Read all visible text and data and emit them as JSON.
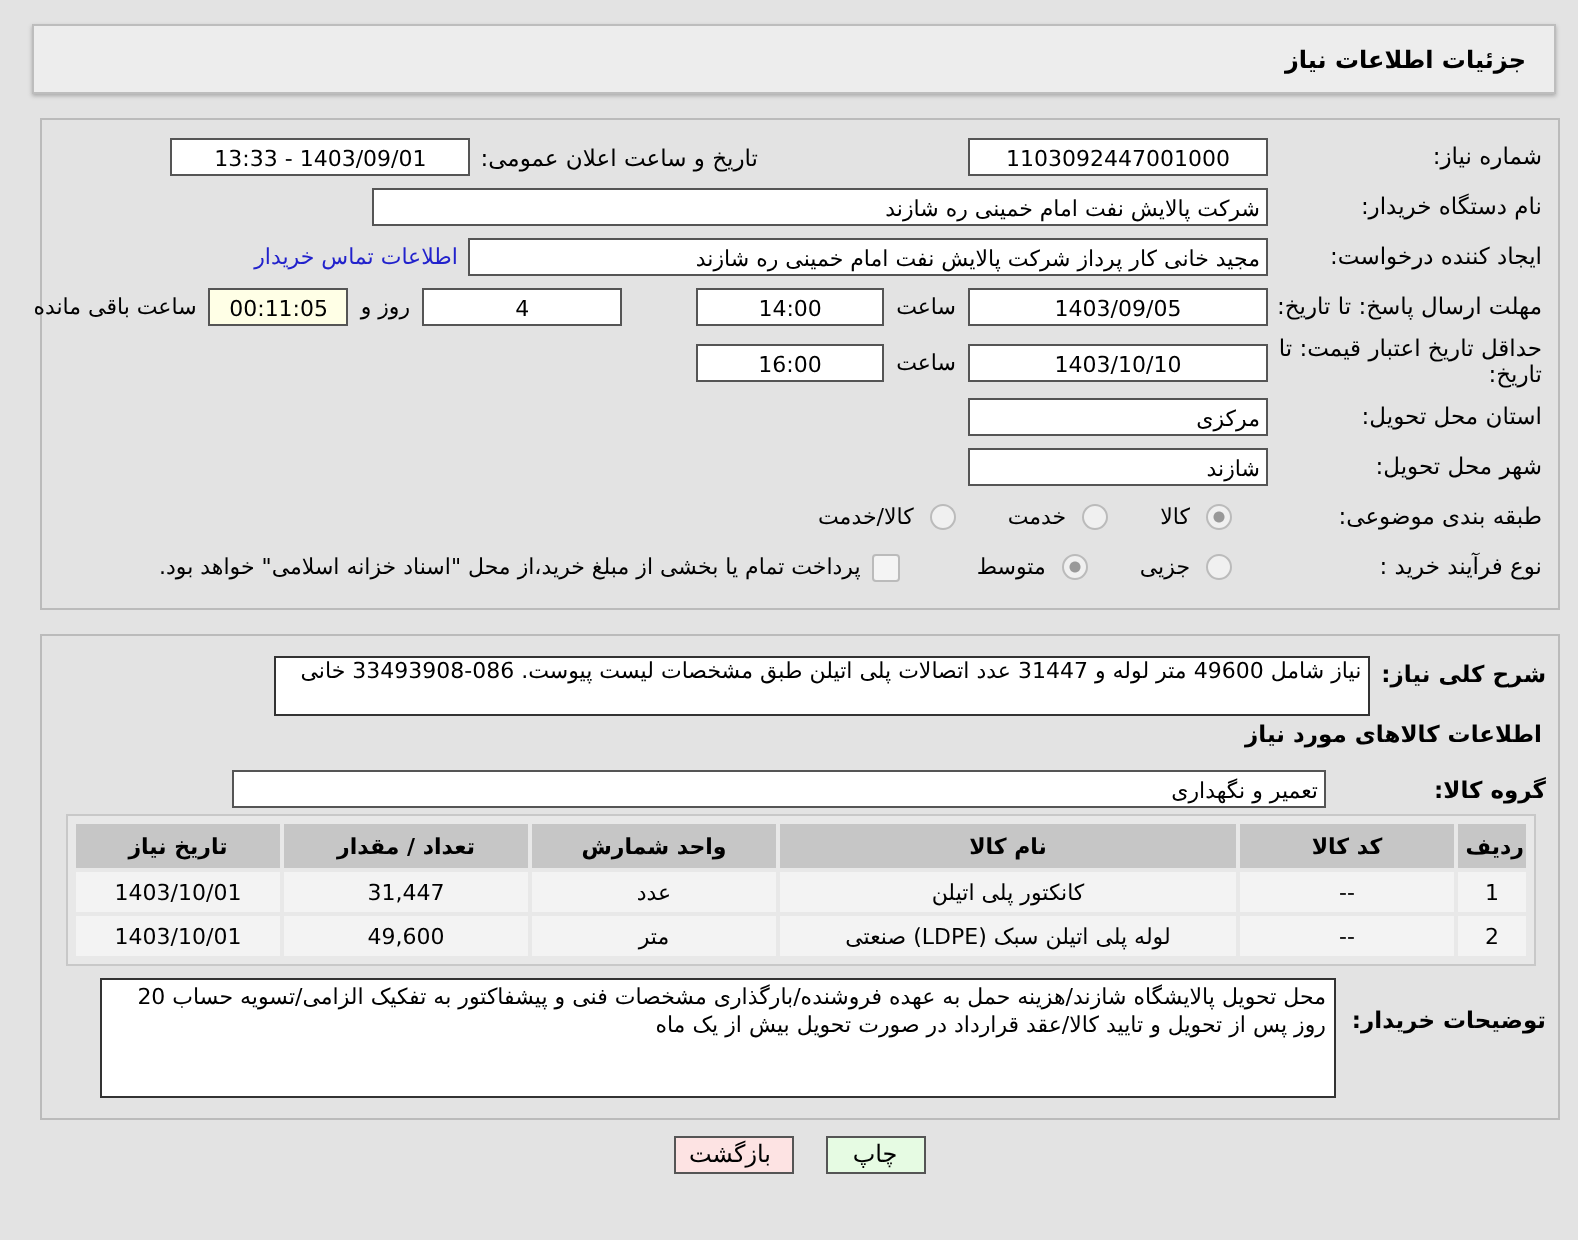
{
  "header": {
    "title": "جزئیات اطلاعات نیاز"
  },
  "details": {
    "need_number": {
      "label": "شماره نیاز:",
      "value": "1103092447001000"
    },
    "announce": {
      "label": "تاریخ و ساعت اعلان عمومی:",
      "value": "1403/09/01 - 13:33"
    },
    "buyer": {
      "label": "نام دستگاه خریدار:",
      "value": "شرکت پالایش نفت امام خمینی  ره  شازند"
    },
    "creator": {
      "label": "ایجاد کننده درخواست:",
      "value": "مجید خانی کار پرداز شرکت پالایش نفت امام خمینی  ره  شازند",
      "link": "اطلاعات تماس خریدار"
    },
    "reply_deadline": {
      "label": "مهلت ارسال پاسخ: تا تاریخ:",
      "date": "1403/09/05",
      "time_label": "ساعت",
      "time": "14:00",
      "days": "4",
      "days_label": "روز و",
      "remaining": "00:11:05",
      "remaining_label": "ساعت باقی مانده"
    },
    "price_validity": {
      "label": "حداقل تاریخ اعتبار قیمت: تا تاریخ:",
      "date": "1403/10/10",
      "time_label": "ساعت",
      "time": "16:00"
    },
    "province": {
      "label": "استان محل تحویل:",
      "value": "مرکزی"
    },
    "city": {
      "label": "شهر محل تحویل:",
      "value": "شازند"
    },
    "category": {
      "label": "طبقه بندی موضوعی:",
      "options": [
        {
          "label": "کالا",
          "selected": true,
          "disabled": true
        },
        {
          "label": "خدمت",
          "selected": false,
          "disabled": true
        },
        {
          "label": "کالا/خدمت",
          "selected": false,
          "disabled": true
        }
      ]
    },
    "process": {
      "label": "نوع فرآیند خرید :",
      "options": [
        {
          "label": "جزیی",
          "selected": false,
          "disabled": true
        },
        {
          "label": "متوسط",
          "selected": true,
          "disabled": true
        }
      ],
      "treasury": {
        "label": "پرداخت تمام یا بخشی از مبلغ خرید،از محل \"اسناد خزانه اسلامی\" خواهد بود.",
        "checked": false
      }
    }
  },
  "need": {
    "label": "شرح کلی نیاز:",
    "value": "نیاز شامل 49600 متر لوله و 31447 عدد اتصالات پلی اتیلن طبق مشخصات لیست پیوست. 086-33493908 خانی",
    "goods_heading": "اطلاعات کالاهای مورد نیاز",
    "group": {
      "label": "گروه کالا:",
      "value": "تعمیر و نگهداری"
    },
    "table": {
      "columns": [
        "ردیف",
        "کد کالا",
        "نام کالا",
        "واحد شمارش",
        "تعداد / مقدار",
        "تاریخ نیاز"
      ],
      "rows": [
        [
          "1",
          "--",
          "کانکتور پلی اتیلن",
          "عدد",
          "31,447",
          "1403/10/01"
        ],
        [
          "2",
          "--",
          "لوله پلی اتیلن سبک (LDPE) صنعتی",
          "متر",
          "49,600",
          "1403/10/01"
        ]
      ]
    },
    "notes": {
      "label": "توضیحات خریدار:",
      "value": "محل تحویل پالایشگاه شازند/هزینه حمل به عهده فروشنده/بارگذاری مشخصات فنی و پیشفاکتور به تفکیک الزامی/تسویه حساب 20 روز پس از تحویل و تایید کالا/عقد قرارداد در صورت تحویل بیش از یک ماه"
    }
  },
  "buttons": [
    {
      "label": "چاپ",
      "kind": "print"
    },
    {
      "label": "بازگشت",
      "kind": "back"
    }
  ]
}
